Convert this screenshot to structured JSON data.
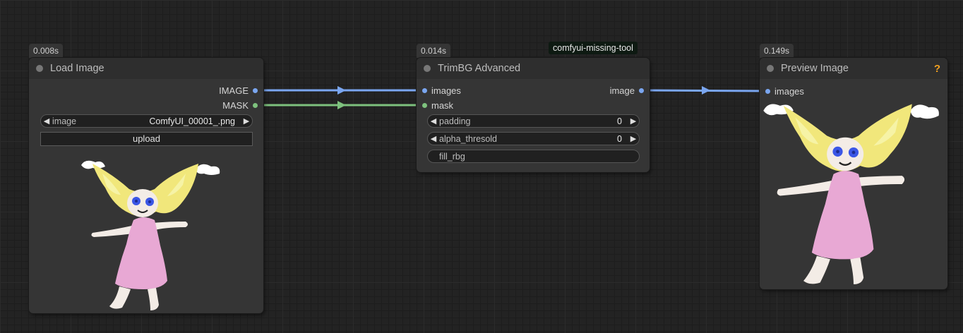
{
  "nodes": {
    "load_image": {
      "timing": "0.008s",
      "title": "Load Image",
      "outputs": [
        "IMAGE",
        "MASK"
      ],
      "image_widget": {
        "label": "image",
        "value": "ComfyUI_00001_.png"
      },
      "upload_label": "upload"
    },
    "trimbg": {
      "timing": "0.014s",
      "badge": "comfyui-missing-tool",
      "title": "TrimBG Advanced",
      "inputs": [
        "images",
        "mask"
      ],
      "output": "image",
      "widgets": [
        {
          "label": "padding",
          "value": "0"
        },
        {
          "label": "alpha_thresold",
          "value": "0"
        }
      ],
      "fill_label": "fill_rbg"
    },
    "preview": {
      "timing": "0.149s",
      "title": "Preview Image",
      "help": "?",
      "input": "images"
    }
  },
  "colors": {
    "image_link": "#7aa6f0",
    "mask_link": "#7ec27e",
    "help": "#f0a020"
  }
}
